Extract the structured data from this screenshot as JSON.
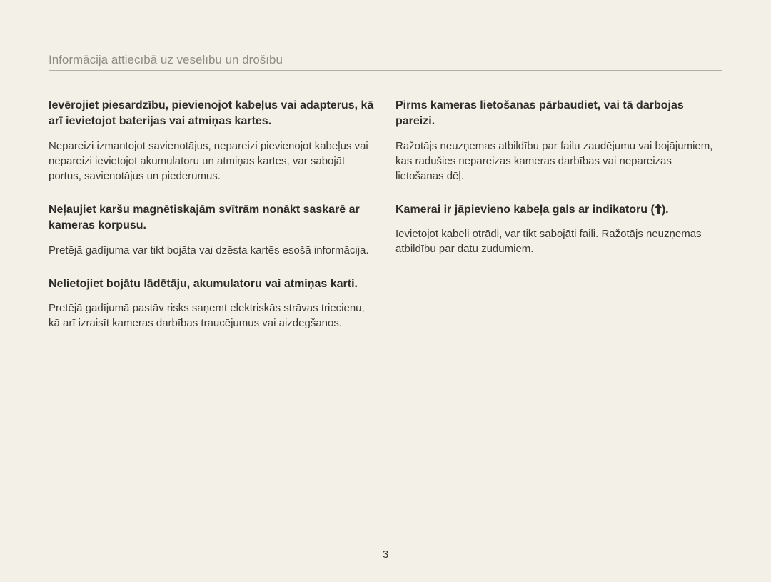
{
  "header": {
    "title": "Informācija attiecībā uz veselību un drošību"
  },
  "leftColumn": {
    "sections": [
      {
        "heading": "Ievērojiet piesardzību, pievienojot kabeļus vai adapterus, kā arī ievietojot baterijas vai atmiņas kartes.",
        "body": "Nepareizi izmantojot savienotājus, nepareizi pievienojot kabeļus vai nepareizi ievietojot akumulatoru un atmiņas kartes, var sabojāt portus, savienotājus un piederumus."
      },
      {
        "heading": "Neļaujiet karšu magnētiskajām svītrām nonākt saskarē ar kameras korpusu.",
        "body": "Pretējā gadījuma var tikt bojāta vai dzēsta kartēs esošā informācija."
      },
      {
        "heading": "Nelietojiet bojātu lādētāju, akumulatoru vai atmiņas karti.",
        "body": "Pretējā gadījumā pastāv risks saņemt elektriskās strāvas triecienu, kā arī izraisīt kameras darbības traucējumus vai aizdegšanos."
      }
    ]
  },
  "rightColumn": {
    "sections": [
      {
        "heading": "Pirms kameras lietošanas pārbaudiet, vai tā darbojas pareizi.",
        "body": "Ražotājs neuzņemas atbildību par failu zaudējumu vai bojājumiem, kas radušies nepareizas kameras darbības vai nepareizas lietošanas dēļ."
      },
      {
        "headingPrefix": "Kamerai ir jāpievieno kabeļa gals ar indikatoru (",
        "headingSuffix": ").",
        "body": "Ievietojot kabeli otrādi, var tikt sabojāti faili. Ražotājs neuzņemas atbildību par datu zudumiem."
      }
    ]
  },
  "pageNumber": "3"
}
